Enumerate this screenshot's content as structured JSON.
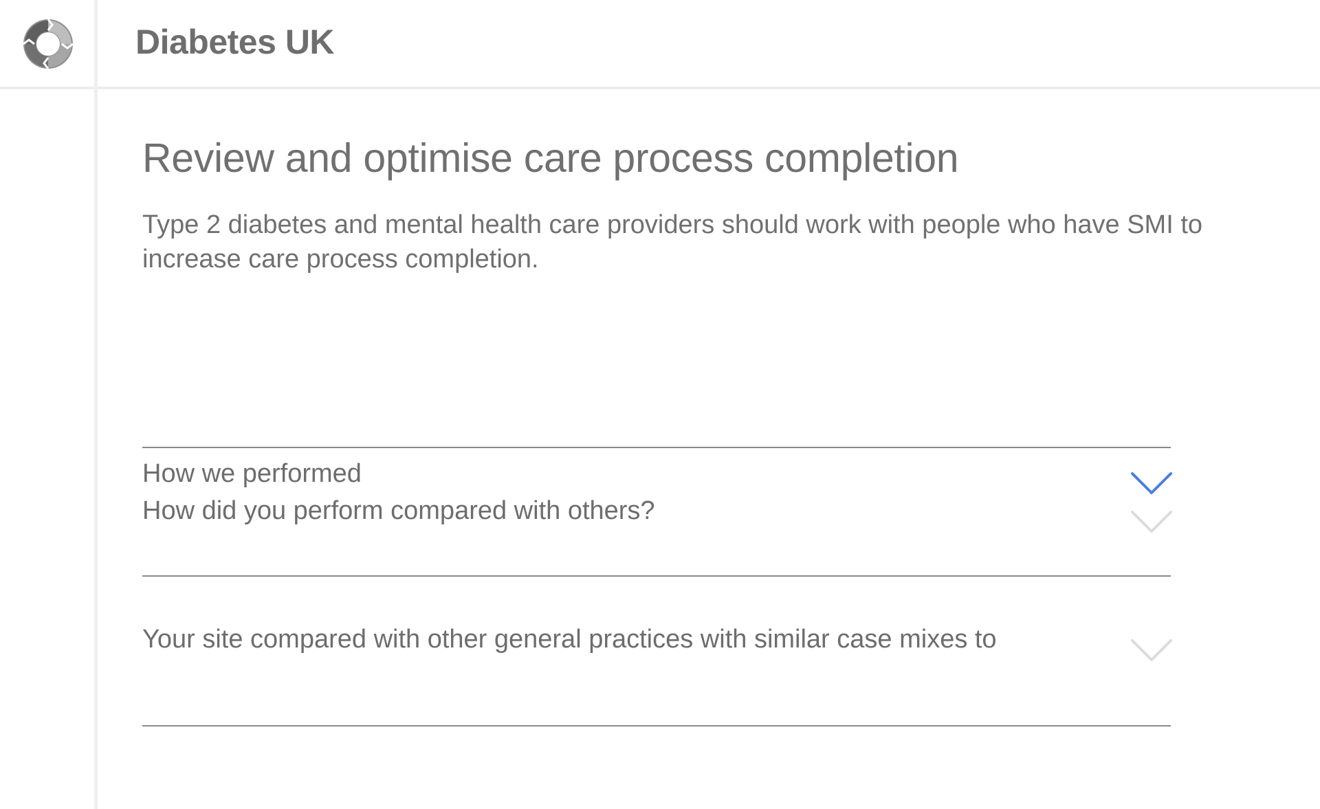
{
  "header": {
    "app_title": "Diabetes UK",
    "logo_icon": "circular-arrows-logo-icon"
  },
  "main": {
    "heading": "Review and optimise care process completion",
    "intro": "Type 2 diabetes and mental health care providers should work with people who have SMI to increase care process completion.",
    "accordion": [
      {
        "label": "How we performed",
        "icon": "chevron-down-icon",
        "active": true
      },
      {
        "label": "How did you perform compared with others?",
        "icon": "chevron-down-icon",
        "active": false
      },
      {
        "label": "Your site compared with other general practices with similar case mixes to",
        "icon": "chevron-down-icon",
        "active": false
      }
    ]
  },
  "colors": {
    "accent": "#4a7fe0",
    "text": "#6f6f6f",
    "chevron_inactive": "#dcdcdc",
    "divider": "#8a8a8a"
  }
}
